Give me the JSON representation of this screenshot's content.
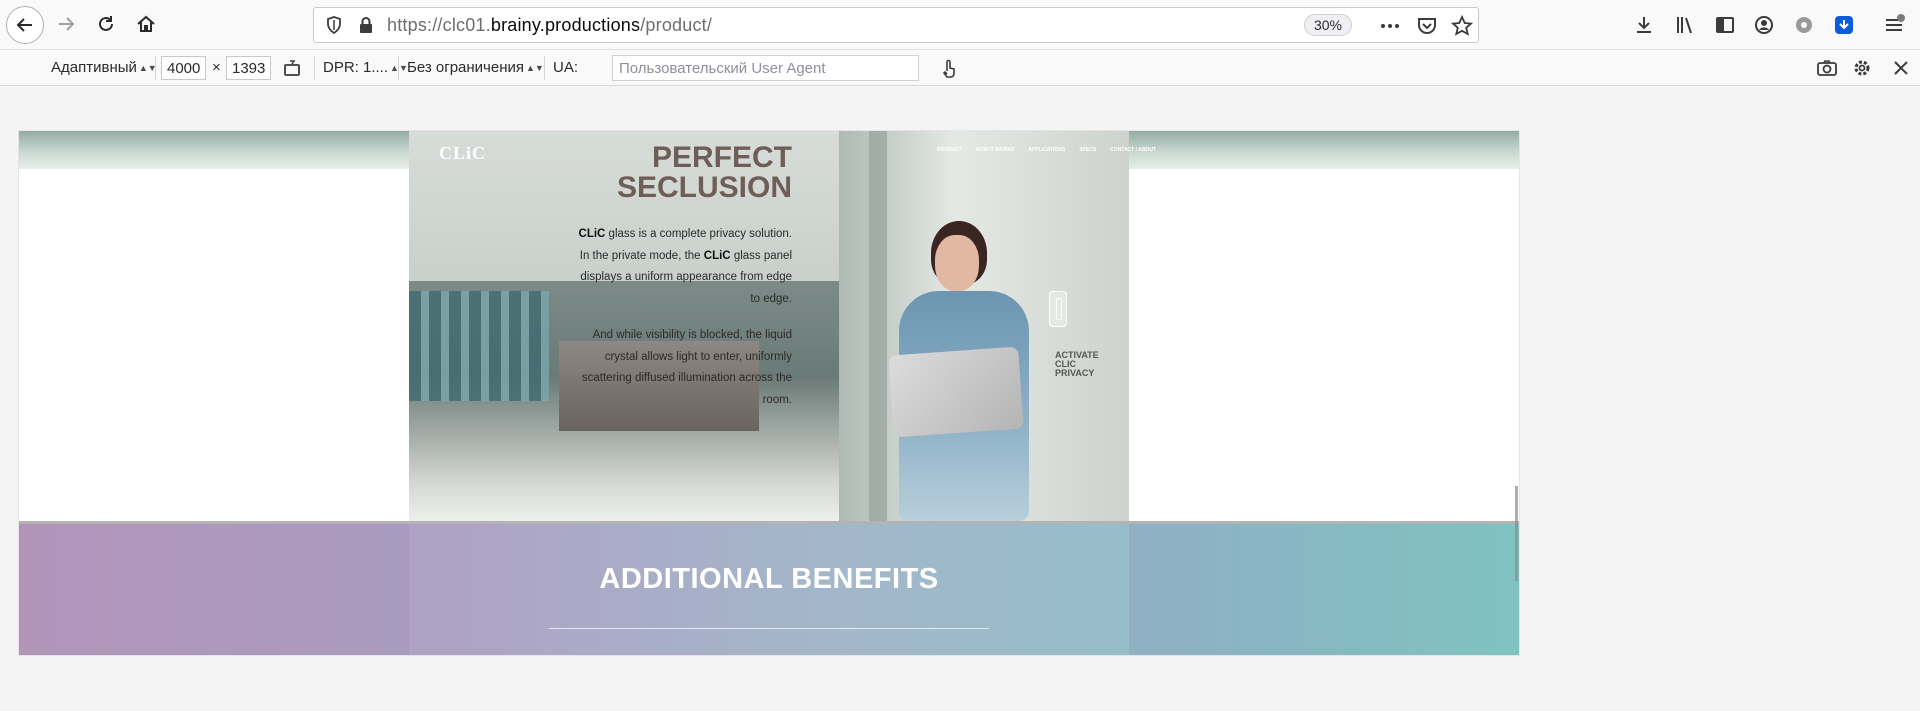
{
  "browser": {
    "url_prefix": "https://clc01.",
    "url_domain": "brainy.productions",
    "url_path": "/product/",
    "zoom": "30%",
    "nav_icons": [
      "back-icon",
      "forward-icon",
      "reload-icon",
      "home-icon"
    ],
    "toolbar_icons": [
      "downloads-icon",
      "library-icon",
      "sidebar-icon",
      "account-icon",
      "extension-gear-icon",
      "extension-download-icon",
      "menu-icon"
    ]
  },
  "rdm": {
    "device": "Адаптивный",
    "width": "4000",
    "x_label": "×",
    "height": "1393",
    "dpr": "DPR: 1....",
    "throttling": "Без ограничения",
    "ua_label": "UA:",
    "ua_placeholder": "Пользовательский User Agent"
  },
  "site": {
    "logo": "CLiC",
    "nav": [
      "PRODUCT",
      "HOW IT WORKS",
      "APPLICATIONS",
      "SPECS",
      "CONTACT / ABOUT"
    ],
    "hero_title_line1": "PERFECT",
    "hero_title_line2": "SECLUSION",
    "para1_brand": "CLiC",
    "para1_part1": " glass is a complete privacy solution. In the private mode, the ",
    "para1_brand2": "CLiC",
    "para1_part2": " glass panel displays a uniform appearance from edge to edge.",
    "para2": "And while visibility is blocked, the liquid crystal allows light to enter, uniformly scattering diffused illumination across the room.",
    "activate_line1": "ACTIVATE",
    "activate_line2": "CLIC",
    "activate_line3": "PRIVACY",
    "benefits_title": "ADDITIONAL BENEFITS"
  }
}
